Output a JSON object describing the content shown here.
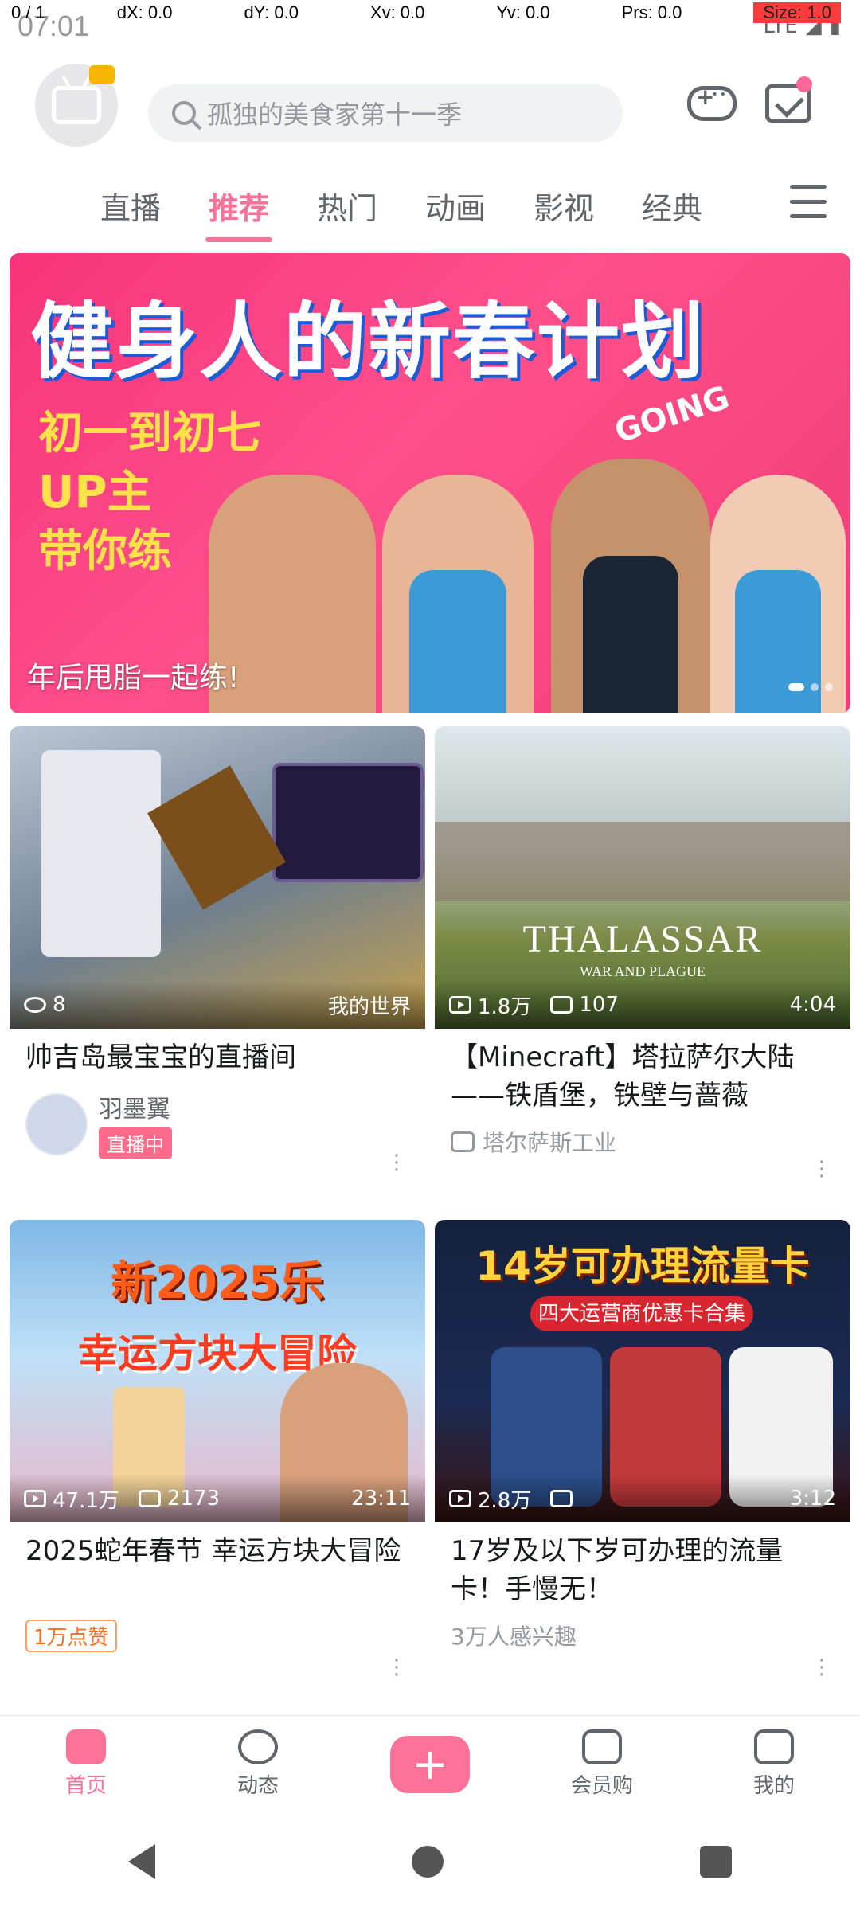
{
  "debug": {
    "pointer": "0 / 1",
    "dx": "dX: 0.0",
    "dy": "dY: 0.0",
    "xv": "Xv: 0.0",
    "yv": "Yv: 0.0",
    "prs": "Prs: 0.0",
    "size": "Size: 1.0"
  },
  "status": {
    "time": "07:01",
    "network": "LTE"
  },
  "header": {
    "search_placeholder": "孤独的美食家第十一季"
  },
  "tabs": [
    "直播",
    "推荐",
    "热门",
    "动画",
    "影视",
    "经典"
  ],
  "active_tab": "推荐",
  "banner": {
    "headline": "健身人的新春计划",
    "sub1": "初一到初七",
    "sub2": "UP主",
    "sub3": "带你练",
    "going": "GOING",
    "caption": "年后甩脂一起练!"
  },
  "cards": [
    {
      "views": "8",
      "right": "我的世界",
      "title": "帅吉岛最宝宝的直播间",
      "author": "羽墨翼",
      "live_badge": "直播中"
    },
    {
      "views": "1.8万",
      "danmaku": "107",
      "duration": "4:04",
      "overlay_title": "THALASSAR",
      "overlay_sub": "WAR AND PLAGUE",
      "title": "【Minecraft】塔拉萨尔大陆——铁盾堡，铁壁与蔷薇",
      "author": "塔尔萨斯工业"
    },
    {
      "views": "47.1万",
      "danmaku": "2173",
      "duration": "23:11",
      "overlay_title": "幸运方块大冒险",
      "overlay_top": "新2025乐",
      "title": "2025蛇年春节 幸运方块大冒险",
      "tag": "1万点赞"
    },
    {
      "views": "2.8万",
      "danmaku": "",
      "duration": "3:12",
      "overlay_title": "14岁可办理流量卡",
      "overlay_sub": "四大运营商优惠卡合集",
      "title": "17岁及以下岁可办理的流量卡！手慢无！",
      "meta": "3万人感兴趣"
    }
  ],
  "bottom_nav": [
    "首页",
    "动态",
    "",
    "会员购",
    "我的"
  ],
  "colors": {
    "accent": "#fb7299",
    "banner": "#f7347a"
  }
}
